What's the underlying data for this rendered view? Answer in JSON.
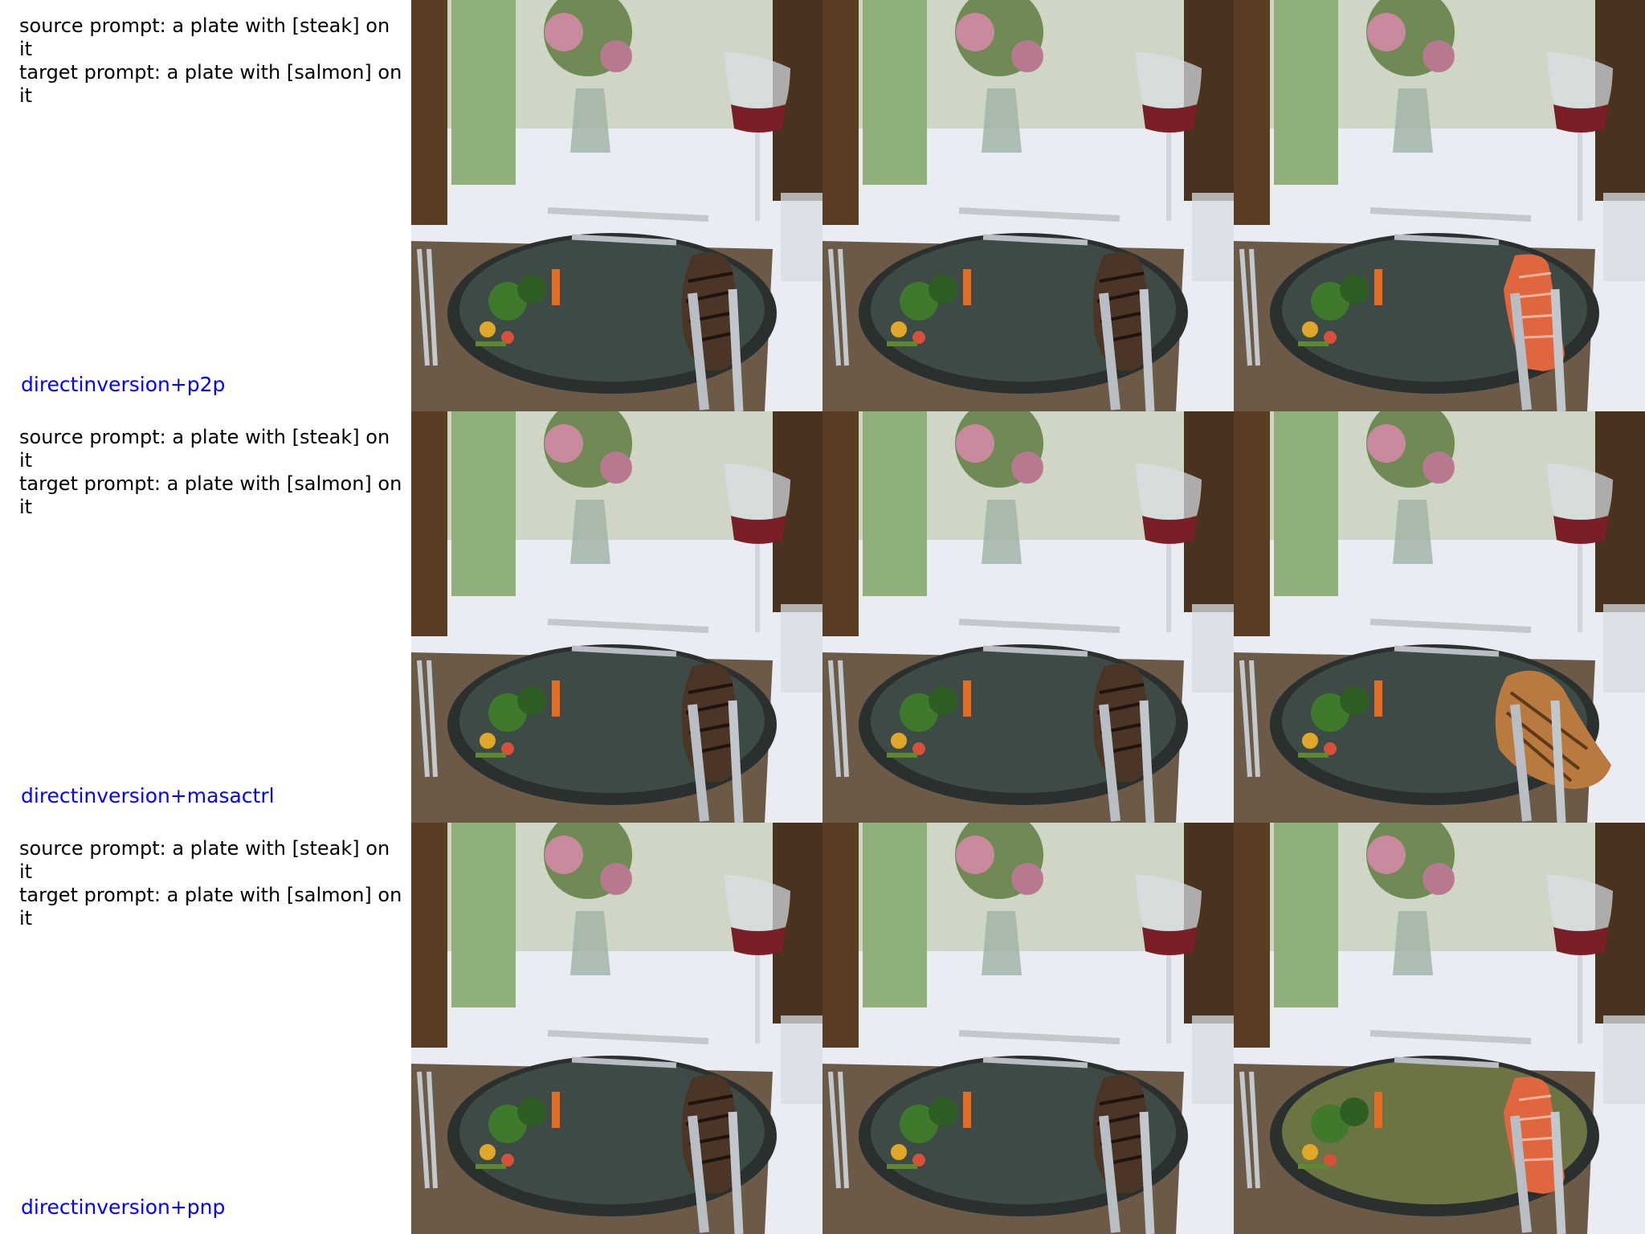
{
  "rows": [
    {
      "source_prompt": "source prompt: a plate with [steak] on it",
      "target_prompt": "target prompt: a plate with [salmon] on it",
      "method": "directinversion+p2p",
      "images": [
        "source",
        "reconstruction",
        "edited"
      ]
    },
    {
      "source_prompt": "source prompt: a plate with [steak] on it",
      "target_prompt": "target prompt: a plate with [salmon] on it",
      "method": "directinversion+masactrl",
      "images": [
        "source",
        "reconstruction",
        "edited"
      ]
    },
    {
      "source_prompt": "source prompt: a plate with [steak] on it",
      "target_prompt": "target prompt: a plate with [salmon] on it",
      "method": "directinversion+pnp",
      "images": [
        "source",
        "reconstruction",
        "edited"
      ]
    }
  ],
  "colors": {
    "method_label": "#0000ff",
    "prompt_text": "#000000",
    "steak": "#4a3526",
    "salmon": "#e0663f",
    "plate": "#3e4a46",
    "tablecloth": "#e9ecf3",
    "wine": "#7a1e28"
  }
}
